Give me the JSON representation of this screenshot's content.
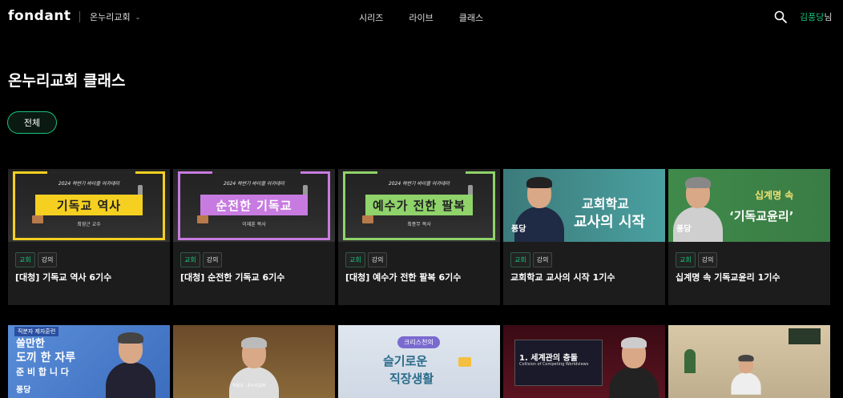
{
  "header": {
    "logo": "fondant",
    "church": "온누리교회",
    "nav": [
      "시리즈",
      "라이브",
      "클래스"
    ],
    "user_name": "김풍당",
    "user_suffix": "님"
  },
  "page_title": "온누리교회 클래스",
  "filter": {
    "all_label": "전체"
  },
  "cards": [
    {
      "title": "[대청] 기독교 역사 6기수",
      "tags": [
        "교회",
        "강의"
      ],
      "thumb_text": "기독교 역사",
      "thumb_academy": "2024 하반기 바이블 아카데미",
      "thumb_speaker": "최영근 교수",
      "accent": "#f5d020"
    },
    {
      "title": "[대청] 순전한 기독교 6기수",
      "tags": [
        "교회",
        "강의"
      ],
      "thumb_text": "순전한 기독교",
      "thumb_academy": "2024 하반기 바이블 아카데미",
      "thumb_speaker": "이재훈 목사",
      "accent": "#c77be0"
    },
    {
      "title": "[대청] 예수가 전한 팔복 6기수",
      "tags": [
        "교회",
        "강의"
      ],
      "thumb_text": "예수가 전한 팔복",
      "thumb_academy": "2024 하반기 바이블 아카데미",
      "thumb_speaker": "최종무 목사",
      "accent": "#8fd36a"
    },
    {
      "title": "교회학교 교사의 시작 1기수",
      "tags": [
        "교회",
        "강의"
      ],
      "thumb_text_1": "교회학교",
      "thumb_text_2": "교사의 시작",
      "thumb_logo": "퐁당"
    },
    {
      "title": "십계명 속 기독교윤리 1기수",
      "tags": [
        "교회",
        "강의"
      ],
      "thumb_text_1": "십계명 속",
      "thumb_text_2": "‘기독교윤리’",
      "thumb_logo": "퐁당"
    }
  ],
  "row2": [
    {
      "badge": "직분자 제자훈련",
      "line1": "쓸만한",
      "line2": "도끼 한 자루",
      "line3": "준 비 합 니 다",
      "logo": "퐁당"
    },
    {
      "caption": "하용조 · 온누리교회"
    },
    {
      "pill": "크리스천의",
      "line1": "슬기로운",
      "line2": "직장생활"
    },
    {
      "line1": "1. 세계관의 충돌",
      "line2": "Collision of Competing Worldviews"
    },
    {
      "sign": ""
    }
  ]
}
